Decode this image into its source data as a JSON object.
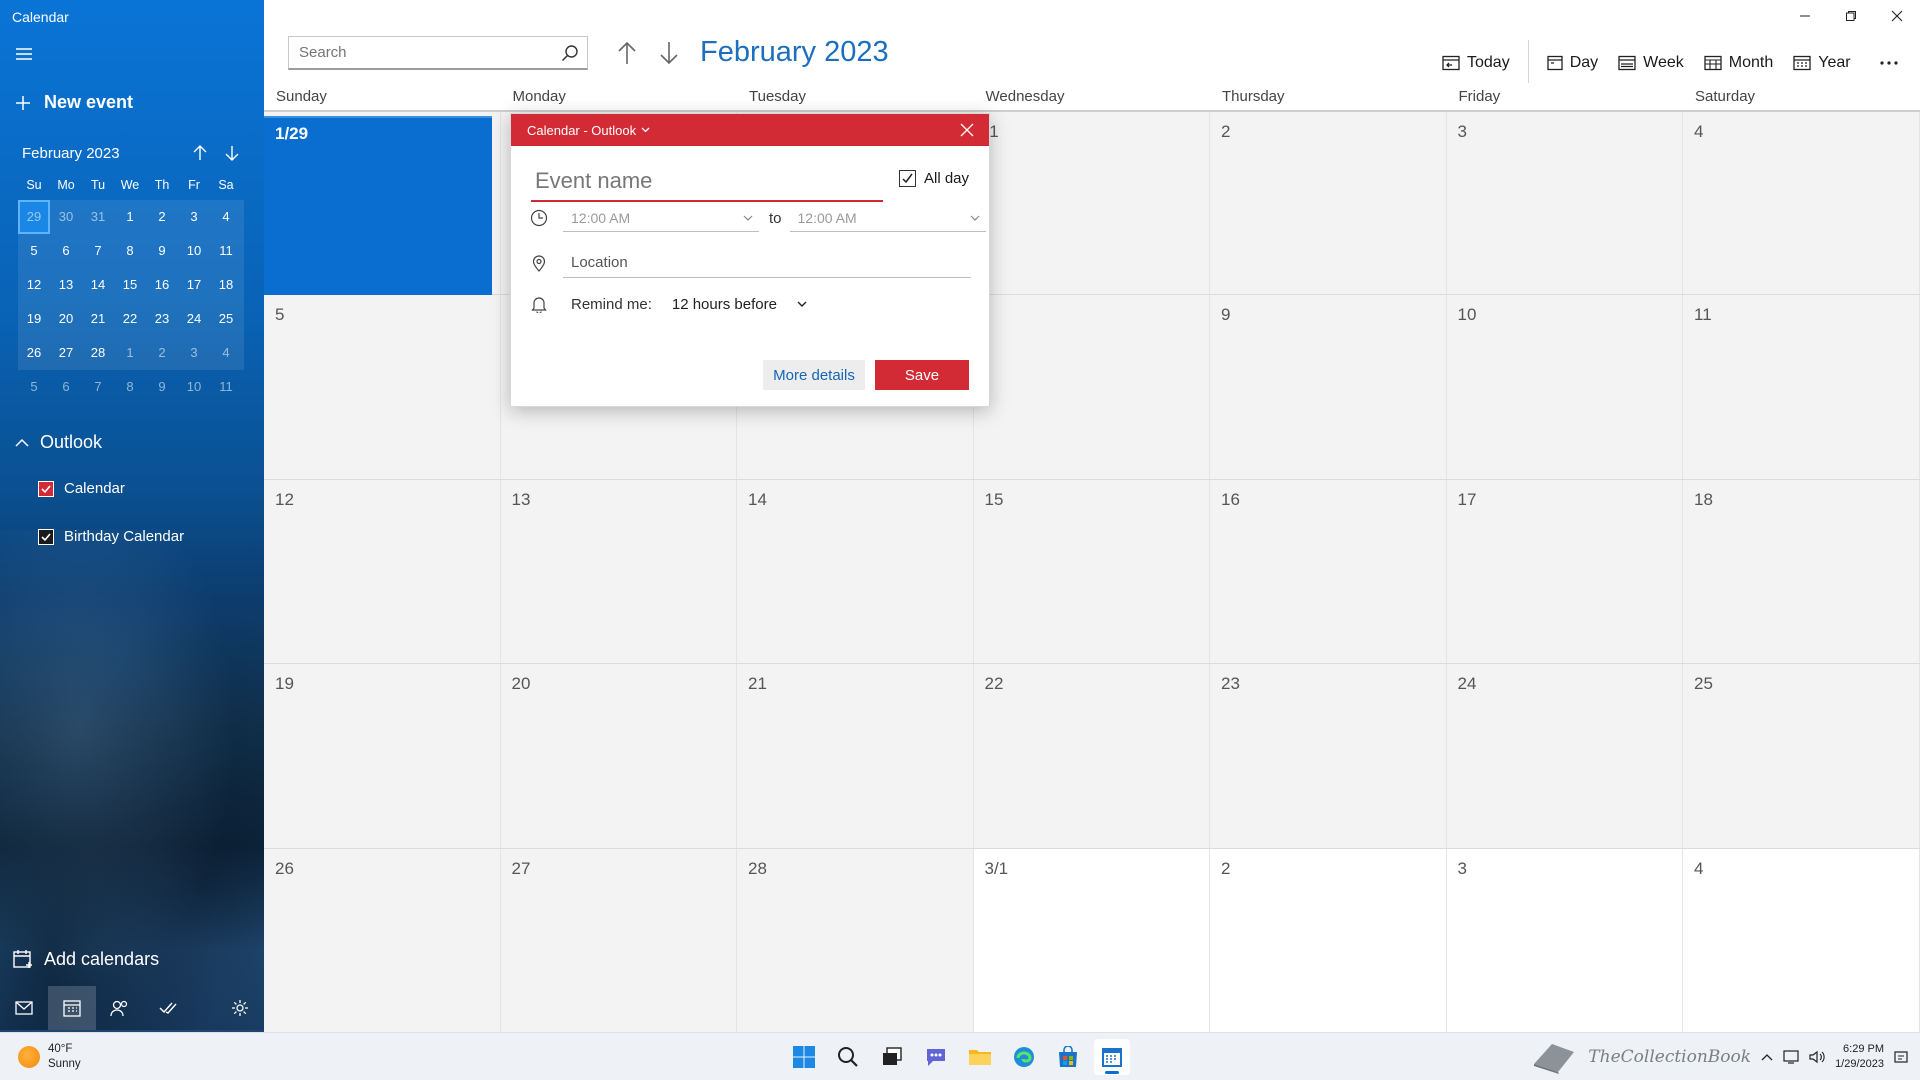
{
  "app": {
    "title": "Calendar"
  },
  "sidebar": {
    "new_event_label": "New event",
    "mini_calendar": {
      "title": "February 2023",
      "weekdays": [
        "Su",
        "Mo",
        "Tu",
        "We",
        "Th",
        "Fr",
        "Sa"
      ],
      "weeks": [
        [
          "29",
          "30",
          "31",
          "1",
          "2",
          "3",
          "4"
        ],
        [
          "5",
          "6",
          "7",
          "8",
          "9",
          "10",
          "11"
        ],
        [
          "12",
          "13",
          "14",
          "15",
          "16",
          "17",
          "18"
        ],
        [
          "19",
          "20",
          "21",
          "22",
          "23",
          "24",
          "25"
        ],
        [
          "26",
          "27",
          "28",
          "1",
          "2",
          "3",
          "4"
        ],
        [
          "5",
          "6",
          "7",
          "8",
          "9",
          "10",
          "11"
        ]
      ]
    },
    "section_label": "Outlook",
    "calendars": [
      {
        "label": "Calendar",
        "color": "#d32b35",
        "checked": true
      },
      {
        "label": "Birthday Calendar",
        "color": "#1a1a1a",
        "checked": true
      }
    ],
    "add_calendars_label": "Add calendars"
  },
  "toolbar": {
    "search_placeholder": "Search",
    "month_title": "February 2023",
    "views": {
      "today": "Today",
      "day": "Day",
      "week": "Week",
      "month": "Month",
      "year": "Year"
    }
  },
  "grid": {
    "weekdays": [
      "Sunday",
      "Monday",
      "Tuesday",
      "Wednesday",
      "Thursday",
      "Friday",
      "Saturday"
    ],
    "weeks": [
      [
        "1/29",
        "",
        "",
        "/1",
        "2",
        "3",
        "4"
      ],
      [
        "5",
        "",
        "",
        "",
        "9",
        "10",
        "11"
      ],
      [
        "12",
        "13",
        "14",
        "15",
        "16",
        "17",
        "18"
      ],
      [
        "19",
        "20",
        "21",
        "22",
        "23",
        "24",
        "25"
      ],
      [
        "26",
        "27",
        "28",
        "3/1",
        "2",
        "3",
        "4"
      ]
    ]
  },
  "popup": {
    "account_label": "Calendar - Outlook",
    "event_name_placeholder": "Event name",
    "all_day_label": "All day",
    "start_time": "12:00 AM",
    "to_label": "to",
    "end_time": "12:00 AM",
    "location_placeholder": "Location",
    "remind_label": "Remind me:",
    "remind_value": "12 hours before",
    "more_details_label": "More details",
    "save_label": "Save"
  },
  "taskbar": {
    "temperature": "40°F",
    "condition": "Sunny",
    "watermark": "TheCollectionBook",
    "time": "6:29 PM",
    "date": "1/29/2023"
  },
  "colors": {
    "accent": "#0a6ed1",
    "event_red": "#d32b35",
    "title_blue": "#1c6fbe"
  }
}
